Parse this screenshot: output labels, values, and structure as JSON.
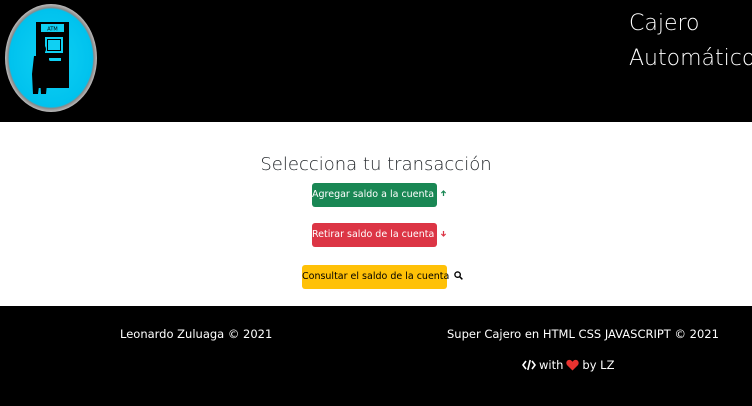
{
  "header": {
    "brand_line1": "Cajero",
    "brand_line2": "Automático",
    "logo_text": "ATM"
  },
  "main": {
    "title": "Selecciona tu transacción",
    "buttons": {
      "add": "Agregar saldo a la cuenta",
      "withdraw": "Retirar saldo de la cuenta",
      "balance": "Consultar el saldo de la cuenta"
    }
  },
  "footer": {
    "left": "Leonardo Zuluaga © 2021",
    "right": "Super Cajero en HTML CSS JAVASCRIPT © 2021",
    "made_with": "with",
    "made_by": "by LZ"
  },
  "icons": {
    "add": "plus-circle-icon",
    "withdraw": "minus-circle-icon",
    "balance": "search-icon",
    "code": "code-icon",
    "heart": "heart-icon"
  },
  "colors": {
    "header_bg": "#000000",
    "footer_bg": "#000000",
    "add": "#198754",
    "withdraw": "#dc3545",
    "balance": "#ffc107",
    "heart": "#e8322f",
    "logo": "#00c2ee"
  }
}
